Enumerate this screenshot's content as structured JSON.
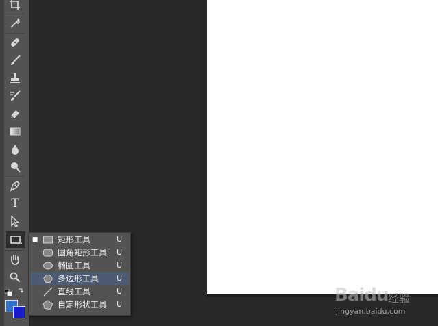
{
  "document": {
    "background_color": "#ffffff",
    "workspace_color": "#282828"
  },
  "toolbar": {
    "tools": [
      {
        "icon": "crop-icon"
      },
      {
        "icon": "eyedropper-icon"
      },
      {
        "icon": "healing-brush-icon"
      },
      {
        "icon": "brush-icon"
      },
      {
        "icon": "clone-stamp-icon"
      },
      {
        "icon": "history-brush-icon"
      },
      {
        "icon": "eraser-icon"
      },
      {
        "icon": "gradient-icon"
      },
      {
        "icon": "blur-icon"
      },
      {
        "icon": "dodge-icon"
      },
      {
        "icon": "pen-icon"
      },
      {
        "icon": "type-icon",
        "glyph": "T"
      },
      {
        "icon": "path-selection-icon"
      },
      {
        "icon": "rectangle-tool-icon",
        "active": true
      },
      {
        "icon": "hand-icon"
      },
      {
        "icon": "zoom-icon"
      }
    ],
    "foreground_color": "#2f72c7",
    "background_color": "#1a1acf"
  },
  "shape_flyout": {
    "items": [
      {
        "label": "矩形工具",
        "shortcut": "U",
        "icon": "rectangle-icon",
        "current": true
      },
      {
        "label": "圆角矩形工具",
        "shortcut": "U",
        "icon": "rounded-rectangle-icon"
      },
      {
        "label": "椭圆工具",
        "shortcut": "U",
        "icon": "ellipse-icon"
      },
      {
        "label": "多边形工具",
        "shortcut": "U",
        "icon": "polygon-icon",
        "highlighted": true
      },
      {
        "label": "直线工具",
        "shortcut": "U",
        "icon": "line-icon"
      },
      {
        "label": "自定形状工具",
        "shortcut": "U",
        "icon": "custom-shape-icon"
      }
    ]
  },
  "watermark": {
    "logo": "Baidu",
    "brand": "经验",
    "url": "jingyan.baidu.com"
  }
}
